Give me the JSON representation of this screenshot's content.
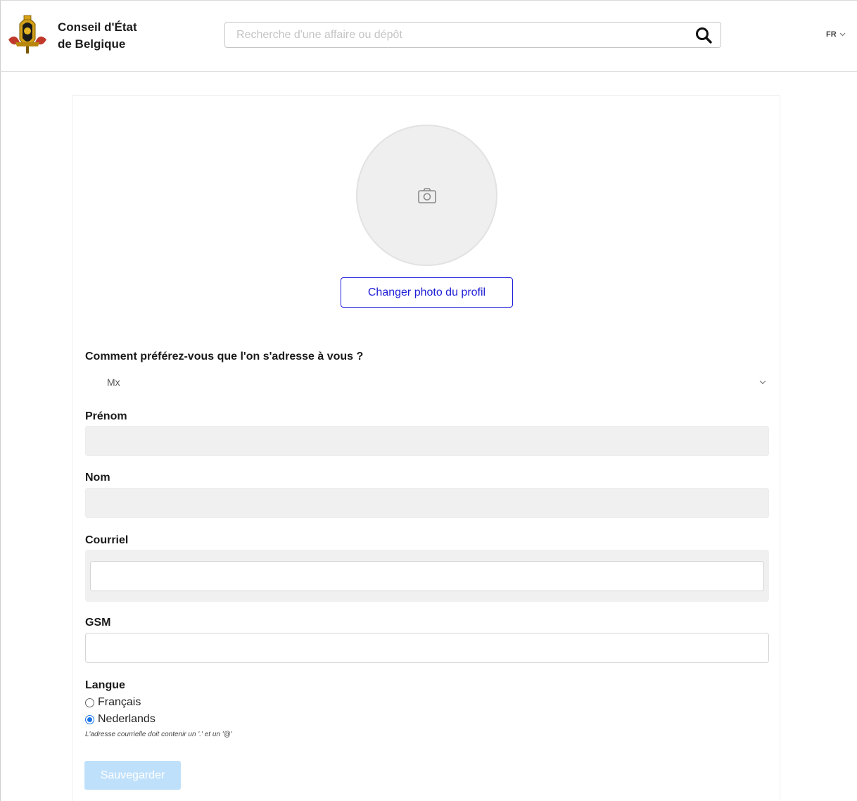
{
  "header": {
    "brand_line1": "Conseil d'État",
    "brand_line2": "de Belgique",
    "search_placeholder": "Recherche d'une affaire ou dépôt",
    "language": "FR",
    "logo_icon": "belgian-coat-of-arms-icon",
    "search_icon": "search-icon",
    "language_chevron_icon": "chevron-down-icon"
  },
  "profile": {
    "avatar_icon": "camera-icon",
    "change_photo_label": "Changer photo du profil"
  },
  "form": {
    "salutation_label": "Comment préférez-vous que l'on s'adresse à vous ?",
    "salutation_value": "Mx",
    "first_name_label": "Prénom",
    "first_name_value": "",
    "last_name_label": "Nom",
    "last_name_value": "",
    "email_label": "Courriel",
    "email_value": "",
    "phone_label": "GSM",
    "phone_value": "",
    "language_label": "Langue",
    "language_options": [
      {
        "label": "Français",
        "selected": false
      },
      {
        "label": "Nederlands",
        "selected": true
      }
    ],
    "email_hint": "L'adresse courrielle doit contenir un '.' et un '@'",
    "save_label": "Sauvegarder"
  },
  "colors": {
    "primary_blue": "#1e1ed8",
    "save_disabled": "#bfe0fb",
    "field_grey": "#f0f0f0"
  }
}
